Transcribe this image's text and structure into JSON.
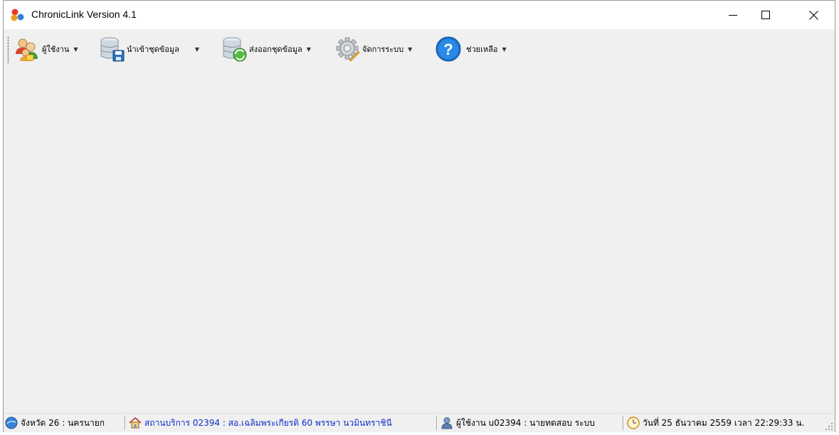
{
  "window": {
    "title": "ChronicLink Version 4.1"
  },
  "toolbar": {
    "items": [
      {
        "label": "ผู้ใช้งาน",
        "icon": "users-icon"
      },
      {
        "label": "นำเข้าชุดข้อมูล",
        "icon": "database-save-icon"
      },
      {
        "label": "ส่งออกชุดข้อมูล",
        "icon": "database-export-icon"
      },
      {
        "label": "จัดการระบบ",
        "icon": "gear-icon"
      },
      {
        "label": "ช่วยเหลือ",
        "icon": "help-icon"
      }
    ],
    "caret": "▼"
  },
  "status": {
    "province": "จังหวัด 26 : นครนายก",
    "service": "สถานบริการ 02394 : สอ.เฉลิมพระเกียรติ 60 พรรษา นวมินทราชินี",
    "user": "ผู้ใช้งาน u02394 : นายทดสอบ ระบบ",
    "datetime": "วันที่ 25 ธันวาคม 2559 เวลา 22:29:33 น."
  }
}
